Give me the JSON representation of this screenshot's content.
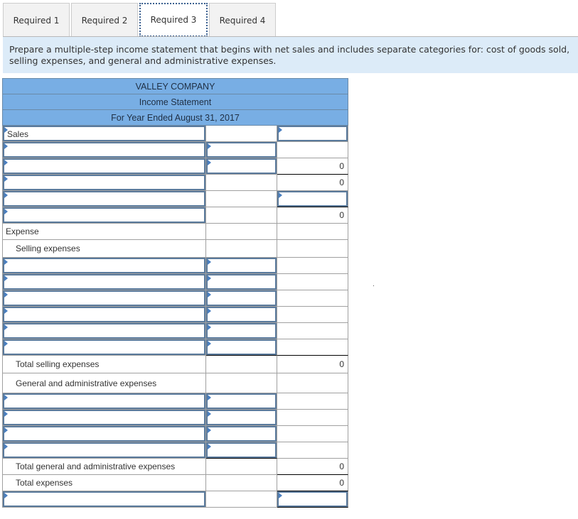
{
  "tabs": [
    {
      "label": "Required 1",
      "active": false
    },
    {
      "label": "Required 2",
      "active": false
    },
    {
      "label": "Required 3",
      "active": true
    },
    {
      "label": "Required 4",
      "active": false
    }
  ],
  "instruction": "Prepare a multiple-step income statement that begins with net sales and includes separate categories for: cost of goods sold, selling expenses, and general and administrative expenses.",
  "statement": {
    "company": "VALLEY COMPANY",
    "title": "Income Statement",
    "period": "For Year Ended August 31, 2017",
    "rows": {
      "sales_label": "Sales",
      "r3_total": "0",
      "r4_total": "0",
      "r6_total": "0",
      "expense_label": "Expense",
      "selling_label": "Selling expenses",
      "total_selling_label": "Total selling expenses",
      "total_selling_value": "0",
      "ga_label": "General and administrative expenses",
      "total_ga_label": "Total general and administrative expenses",
      "total_ga_value": "0",
      "total_expenses_label": "Total expenses",
      "total_expenses_value": "0"
    }
  }
}
